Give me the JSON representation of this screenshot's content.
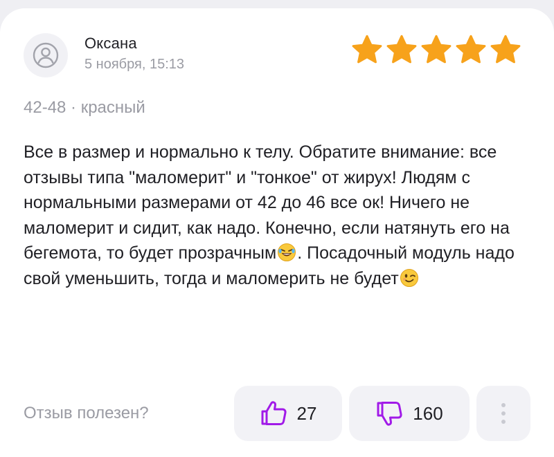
{
  "review": {
    "author": "Оксана",
    "date": "5 ноября, 15:13",
    "rating": 5,
    "rating_max": 5,
    "variant": "42-48 · красный",
    "text_parts": [
      "Все в размер и нормально к телу. Обратите внимание: все отзывы типа \"маломерит\" и \"тонкое\" от жирух! Людям с нормальными размерами от 42 до 46 все ок! Ничего не маломерит и сидит, как надо. Конечно, если натянуть его на бегемота, то будет прозрачным",
      ". Посадочный модуль надо свой уменьшить, тогда и маломерить не будет"
    ],
    "emojis": [
      "rolling-laughing-emoji",
      "winking-emoji"
    ]
  },
  "actions": {
    "helpful_label": "Отзыв полезен?",
    "likes": "27",
    "dislikes": "160"
  },
  "icons": {
    "avatar": "user-icon",
    "like": "thumbs-up-icon",
    "dislike": "thumbs-down-icon",
    "more": "more-vertical-icon"
  },
  "colors": {
    "star": "#f7a21b",
    "accent": "#a11ae8",
    "muted_text": "#9a9ba3",
    "button_bg": "#f2f2f6"
  }
}
